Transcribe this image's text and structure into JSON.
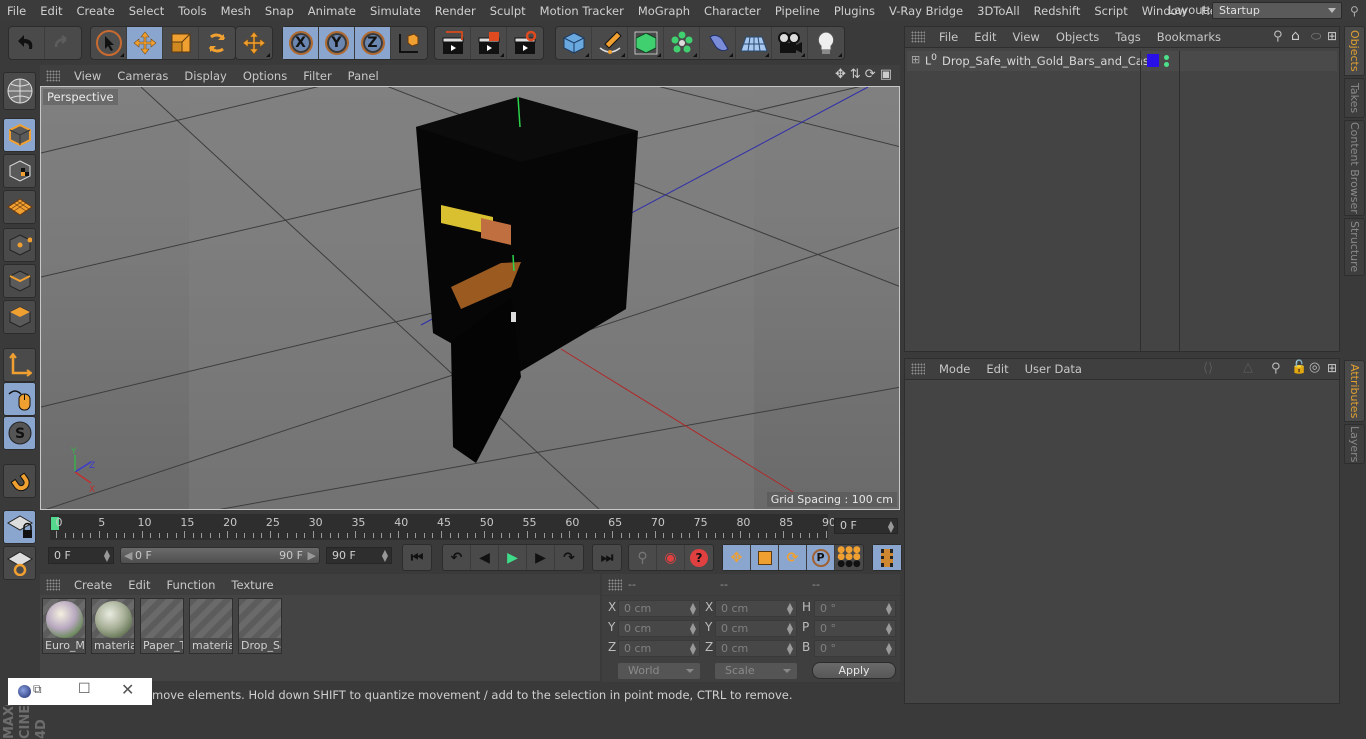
{
  "menubar": {
    "items": [
      "File",
      "Edit",
      "Create",
      "Select",
      "Tools",
      "Mesh",
      "Snap",
      "Animate",
      "Simulate",
      "Render",
      "Sculpt",
      "Motion Tracker",
      "MoGraph",
      "Character",
      "Pipeline",
      "Plugins",
      "V-Ray Bridge",
      "3DToAll",
      "Redshift",
      "Script",
      "Window",
      "Help"
    ],
    "layout_label": "Layout:",
    "layout_value": "Startup"
  },
  "toolbar": {
    "undo": "undo-icon",
    "redo": "redo-icon",
    "axis_x": "X",
    "axis_y": "Y",
    "axis_z": "Z"
  },
  "viewport": {
    "menu": [
      "View",
      "Cameras",
      "Display",
      "Options",
      "Filter",
      "Panel"
    ],
    "camera_label": "Perspective",
    "grid_spacing": "Grid Spacing : 100 cm",
    "axis_labels": {
      "x": "X",
      "y": "Y",
      "z": "Z"
    }
  },
  "timeline": {
    "ticks": [
      0,
      5,
      10,
      15,
      20,
      25,
      30,
      35,
      40,
      45,
      50,
      55,
      60,
      65,
      70,
      75,
      80,
      85,
      90
    ],
    "current_frame": "0 F",
    "playhead_frame": 0
  },
  "transport": {
    "start_field": "0 F",
    "range_start": "0 F",
    "range_end": "90 F",
    "end_field": "90 F"
  },
  "material_manager": {
    "menu": [
      "Create",
      "Edit",
      "Function",
      "Texture"
    ],
    "materials": [
      {
        "label": "Euro_Mo",
        "preview": "euro-banknote-sphere"
      },
      {
        "label": "material",
        "preview": "dollar-banknote-sphere"
      },
      {
        "label": "Paper_Ta",
        "preview": "empty"
      },
      {
        "label": "material",
        "preview": "empty"
      },
      {
        "label": "Drop_Sa",
        "preview": "empty"
      }
    ]
  },
  "coordinates": {
    "headers": [
      "--",
      "--",
      "--"
    ],
    "position": [
      {
        "axis": "X",
        "value": "0 cm"
      },
      {
        "axis": "Y",
        "value": "0 cm"
      },
      {
        "axis": "Z",
        "value": "0 cm"
      }
    ],
    "size": [
      {
        "axis": "X",
        "value": "0 cm"
      },
      {
        "axis": "Y",
        "value": "0 cm"
      },
      {
        "axis": "Z",
        "value": "0 cm"
      }
    ],
    "rotation": [
      {
        "axis": "H",
        "value": "0 °"
      },
      {
        "axis": "P",
        "value": "0 °"
      },
      {
        "axis": "B",
        "value": "0 °"
      }
    ],
    "space_dropdown": "World",
    "mode_dropdown": "Scale",
    "apply_label": "Apply"
  },
  "status": {
    "text": "move elements. Hold down SHIFT to quantize movement / add to the selection in point mode, CTRL to remove."
  },
  "object_manager": {
    "menu": [
      "File",
      "Edit",
      "View",
      "Objects",
      "Tags",
      "Bookmarks"
    ],
    "objects": [
      {
        "name": "Drop_Safe_with_Gold_Bars_and_Cash",
        "layer_color": "#2a10e8",
        "visibility_color": "#4ee08a"
      }
    ]
  },
  "attribute_manager": {
    "menu": [
      "Mode",
      "Edit",
      "User Data"
    ]
  },
  "right_tabs": {
    "top": [
      {
        "label": "Objects",
        "active": true
      },
      {
        "label": "Takes",
        "active": false
      },
      {
        "label": "Content Browser",
        "active": false
      },
      {
        "label": "Structure",
        "active": false
      }
    ],
    "bottom": [
      {
        "label": "Attributes",
        "active": true
      },
      {
        "label": "Layers",
        "active": false
      }
    ]
  },
  "branding": {
    "logo": "MAXON CINEMA 4D"
  },
  "colors": {
    "accent_active": "#8aa6cf",
    "tool_orange": "#f0a030",
    "tab_active": "#e0a030"
  }
}
